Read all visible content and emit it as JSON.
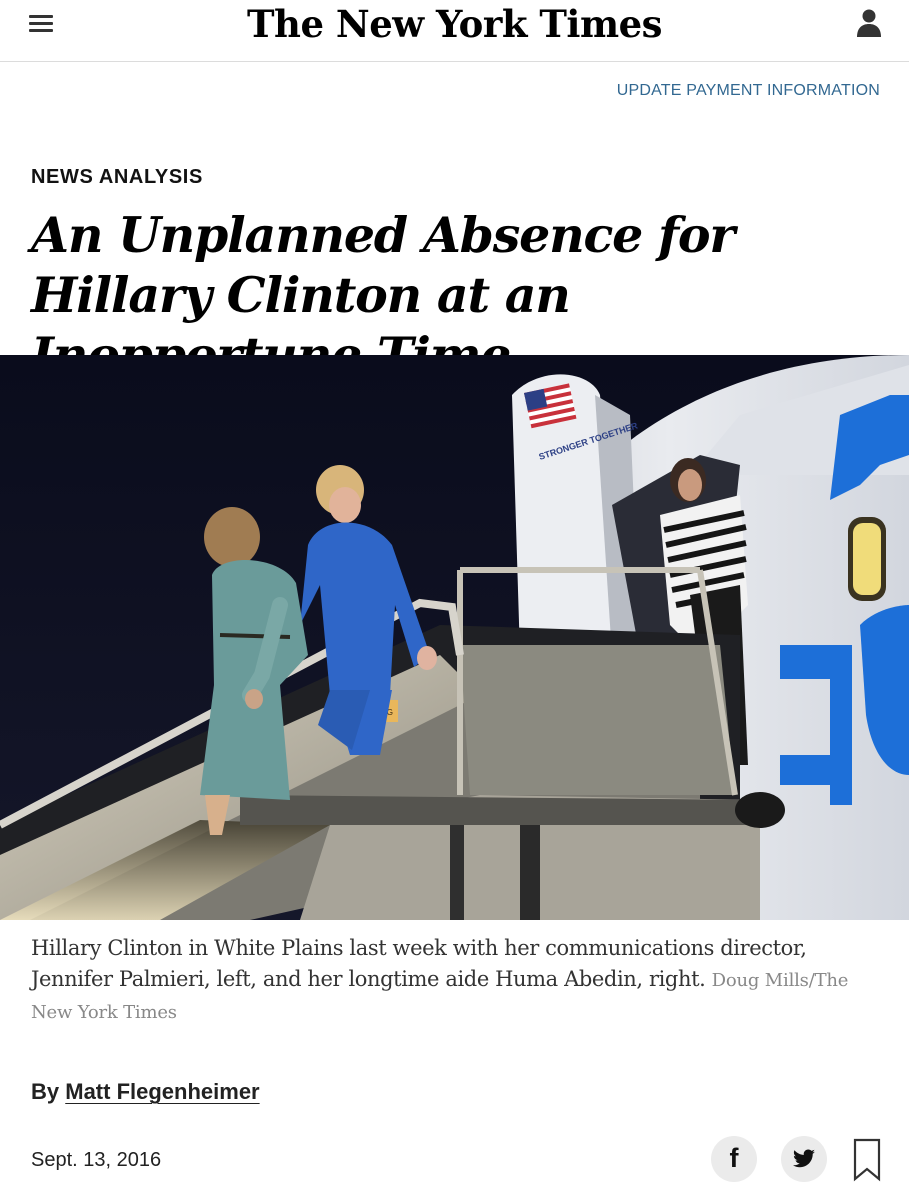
{
  "header": {
    "logo": "The New York Times"
  },
  "payment_link": "UPDATE PAYMENT INFORMATION",
  "article": {
    "kicker": "NEWS ANALYSIS",
    "headline": "An Unplanned Absence for Hillary Clinton at an Inopportune Time",
    "photo": {
      "sign_text": "STRONGER TOGETHER",
      "stair_sign": "NING"
    },
    "caption": "Hillary Clinton in White Plains last week with her communications director, Jennifer Palmieri, left, and her longtime aide Huma Abedin, right.",
    "credit": "Doug Mills/The New York Times",
    "byline_prefix": "By",
    "author": "Matt Flegenheimer",
    "date": "Sept. 13, 2016"
  },
  "share": {
    "facebook_glyph": "f"
  },
  "icons": [
    "hamburger-menu-icon",
    "user-icon",
    "facebook-icon",
    "twitter-icon",
    "bookmark-icon"
  ],
  "colors": {
    "link_blue": "#326891",
    "share_button_bg": "#ebebeb",
    "plane_blue": "#1d6fd8",
    "suit_blue": "#2f66c8"
  }
}
